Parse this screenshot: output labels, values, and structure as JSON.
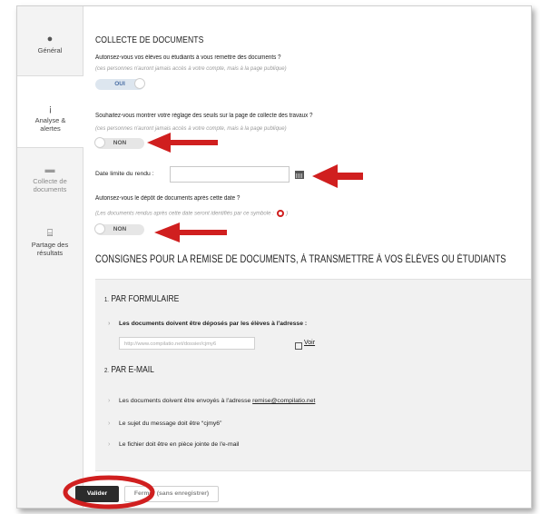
{
  "sidebar": {
    "items": [
      {
        "label": "Général",
        "icon": "info-icon"
      },
      {
        "label_line1": "Analyse &",
        "label_line2": "alertes",
        "icon": "exclamation-icon"
      },
      {
        "label_line1": "Collecte de",
        "label_line2": "documents",
        "icon": "inbox-icon"
      },
      {
        "label_line1": "Partage des",
        "label_line2": "résultats",
        "icon": "presentation-icon"
      }
    ]
  },
  "collect": {
    "title": "COLLECTE DE DOCUMENTS",
    "q1": "Autorisez-vous vos élèves ou étudiants à vous remettre des documents ?",
    "q1_hint": "(ces personnes n'auront jamais accès à votre compte, mais à la page publique)",
    "q1_toggle": "OUI",
    "q2": "Souhaitez-vous montrer votre réglage des seuils sur la page de collecte des travaux ?",
    "q2_hint": "(ces personnes n'auront jamais accès à votre compte, mais à la page publique)",
    "q2_toggle": "NON",
    "date_label": "Date limite du rendu :",
    "date_value": "",
    "q3": "Autorisez-vous le dépôt de documents après cette date ?",
    "q3_hint": "(Les documents rendus après cette date seront identifiés par ce symbole :",
    "q3_hint_end": ")",
    "q3_toggle": "NON"
  },
  "instructions": {
    "title": "CONSIGNES POUR LA REMISE DE DOCUMENTS, À TRANSMETTRE À VOS ÉLÈVES OU ÉTUDIANTS",
    "form": {
      "num": "1.",
      "title": "PAR FORMULAIRE",
      "text": "Les documents doivent être déposés par les élèves à l'adresse :",
      "url": "http://www.compilatio.net/dossier/cjmy6",
      "link": "Voir"
    },
    "email": {
      "num": "2.",
      "title": "PAR E-MAIL",
      "line1_prefix": "Les documents doivent être envoyés à l'adresse ",
      "line1_email": "remise@compilatio.net",
      "line2": "Le sujet du message doit être “cjmy6”",
      "line3": "Le fichier doit être en pièce jointe de l'e-mail"
    }
  },
  "buttons": {
    "validate": "Valider",
    "close": "Fermer (sans enregistrer)"
  },
  "colors": {
    "annotation": "#d01f1f",
    "toggle_on_text": "#4a6fa5",
    "dark_button": "#2b2b2b"
  }
}
